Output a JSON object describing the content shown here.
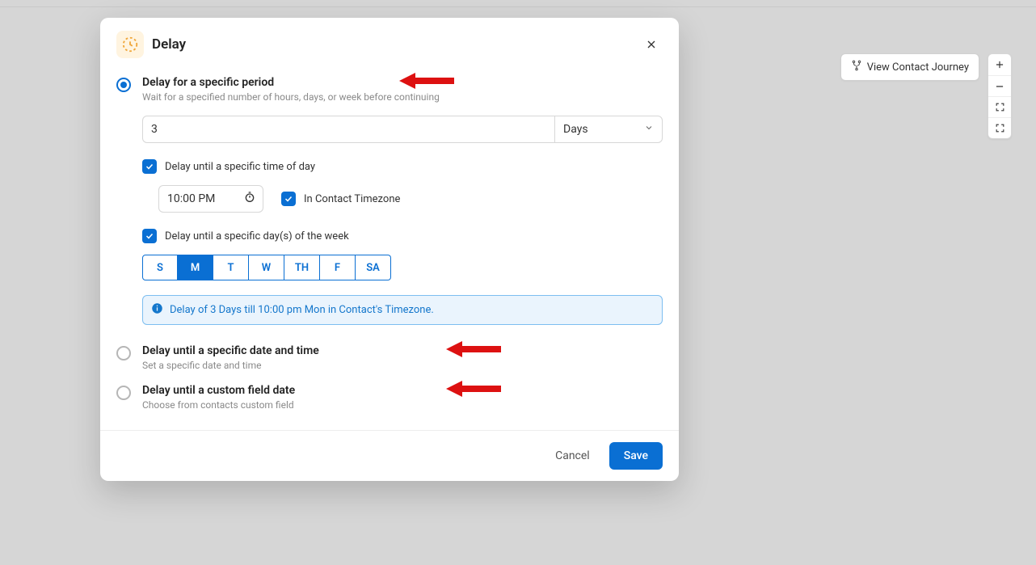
{
  "toolbar": {
    "view_contact_journey": "View Contact Journey"
  },
  "modal": {
    "title": "Delay",
    "option1": {
      "title": "Delay for a specific period",
      "sub": "Wait for a specified number of hours, days, or week before continuing",
      "number_value": "3",
      "unit_value": "Days",
      "chk_time_of_day": "Delay until a specific time of day",
      "time_value": "10:00 PM",
      "chk_contact_tz": "In Contact Timezone",
      "chk_days_of_week": "Delay until a specific day(s) of the week",
      "days": {
        "S": "S",
        "M": "M",
        "T": "T",
        "W": "W",
        "TH": "TH",
        "F": "F",
        "SA": "SA"
      },
      "summary": "Delay of 3 Days till 10:00 pm Mon in Contact's Timezone."
    },
    "option2": {
      "title": "Delay until a specific date and time",
      "sub": "Set a specific date and time"
    },
    "option3": {
      "title": "Delay until a custom field date",
      "sub": "Choose from contacts custom field"
    },
    "cancel": "Cancel",
    "save": "Save"
  }
}
